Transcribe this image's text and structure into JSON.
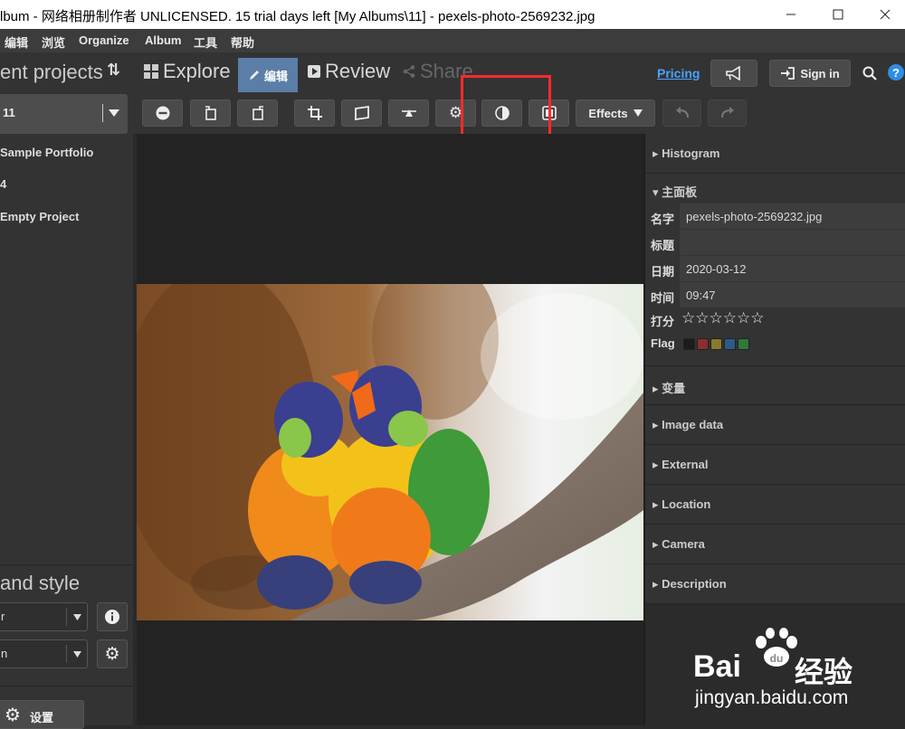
{
  "window": {
    "title": "lbum - 网络相册制作者 UNLICENSED. 15 trial days left [My Albums\\11] - pexels-photo-2569232.jpg"
  },
  "menu": [
    "编辑",
    "浏览",
    "Organize",
    "Album",
    "工具",
    "帮助"
  ],
  "left_panel": {
    "header": "ent projects",
    "selected_project": "11",
    "projects": [
      "Sample Portfolio",
      "4",
      "Empty Project"
    ],
    "bottom_title": "and style",
    "select1_value": "r",
    "select2_value": "n",
    "settings_label": "设置"
  },
  "nav": {
    "tabs": [
      "Explore",
      "编辑",
      "Review",
      "Share"
    ],
    "pricing": "Pricing",
    "signin": "Sign in"
  },
  "toolbar": {
    "effects": "Effects"
  },
  "right_panel": {
    "histogram": "Histogram",
    "main_panel": "主面板",
    "fields": [
      {
        "label": "名字",
        "value": "pexels-photo-2569232.jpg"
      },
      {
        "label": "标题",
        "value": ""
      },
      {
        "label": "日期",
        "value": "2020-03-12"
      },
      {
        "label": "时间",
        "value": "09:47"
      }
    ],
    "rating_label": "打分",
    "rating_value": 0,
    "flag_label": "Flag",
    "flag_colors": [
      "#1c1c1c",
      "#8a2e2e",
      "#8a7a2e",
      "#2e5a8a",
      "#2e7a3a"
    ],
    "sections": [
      "变量",
      "Image data",
      "External",
      "Location",
      "Camera",
      "Description"
    ]
  },
  "watermark": {
    "brand": "Bai",
    "brand_cn": "经验",
    "url": "jingyan.baidu.com"
  },
  "colors": {
    "highlight_box": "#ff2a2a",
    "pricing_link": "#4aa3ff",
    "active_tab": "#5a7ea8"
  }
}
